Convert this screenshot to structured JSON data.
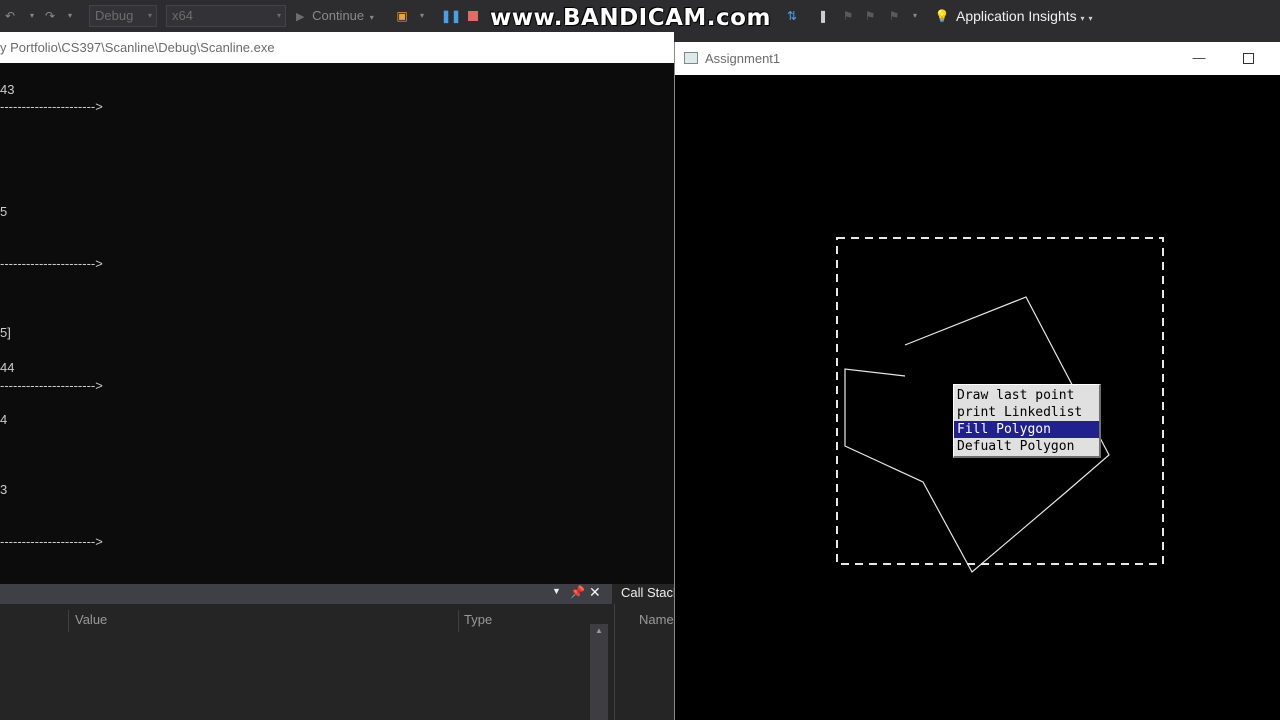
{
  "toolbar": {
    "config": "Debug",
    "platform": "x64",
    "continue_label": "Continue",
    "watermark": "www.BANDICAM.com",
    "app_insights_label": "Application Insights"
  },
  "console": {
    "title": "y Portfolio\\CS397\\Scanline\\Debug\\Scanline.exe",
    "lines": [
      "43",
      "---------------------->",
      "5",
      "---------------------->",
      "5]",
      "44",
      "---------------------->",
      "4",
      "3",
      "---------------------->"
    ]
  },
  "locals": {
    "col_value": "Value",
    "col_type": "Type"
  },
  "callstack": {
    "title": "Call Stack",
    "col_name": "Name"
  },
  "glut": {
    "title": "Assignment1",
    "menu": [
      {
        "label": "Draw last point",
        "selected": false
      },
      {
        "label": "print Linkedlist",
        "selected": false
      },
      {
        "label": "Fill Polygon",
        "selected": true
      },
      {
        "label": "Defualt Polygon",
        "selected": false
      }
    ]
  },
  "colors": {
    "ide_bg": "#2d2d30",
    "console_bg": "#0c0c0c",
    "menu_highlight": "#20208f",
    "menu_bg": "#e0e0e0"
  }
}
